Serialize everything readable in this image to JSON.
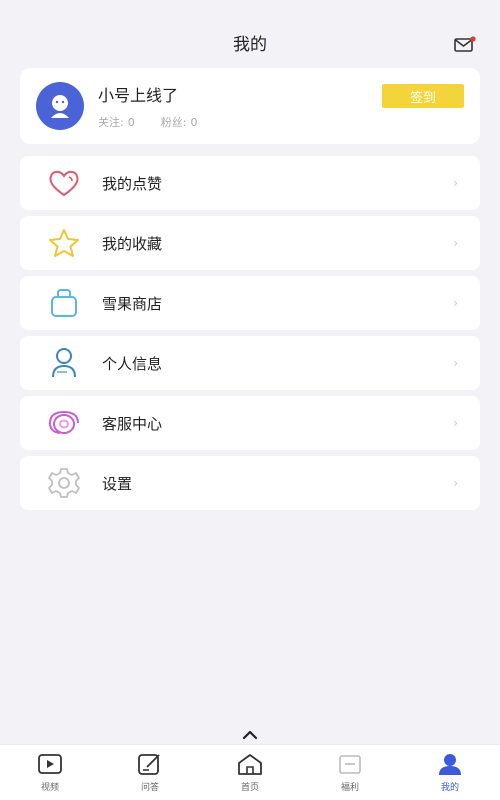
{
  "header": {
    "title": "我的",
    "mail_icon": "mail-icon"
  },
  "profile": {
    "nickname": "小号上线了",
    "follow_label": "关注:",
    "follow_count": "0",
    "fans_label": "粉丝:",
    "fans_count": "0",
    "signin_label": "签到",
    "avatar_icon": "avatar-icon"
  },
  "menu": [
    {
      "label": "我的点赞",
      "icon": "heart-icon",
      "color": "#e2576c"
    },
    {
      "label": "我的收藏",
      "icon": "star-icon",
      "color": "#f2c531"
    },
    {
      "label": "雪果商店",
      "icon": "shopping-bag-icon",
      "color": "#5fb4e6"
    },
    {
      "label": "个人信息",
      "icon": "user-icon",
      "color": "#3b82c4"
    },
    {
      "label": "客服中心",
      "icon": "customer-service-icon",
      "color": "#c85fd1"
    },
    {
      "label": "设置",
      "icon": "gear-icon",
      "color": "#bfbfbf"
    }
  ],
  "tabbar": [
    {
      "label": "视频",
      "icon": "video-icon"
    },
    {
      "label": "问答",
      "icon": "edit-icon"
    },
    {
      "label": "首页",
      "icon": "home-icon"
    },
    {
      "label": "福利",
      "icon": "gift-icon"
    },
    {
      "label": "我的",
      "icon": "profile-icon",
      "active": true
    }
  ],
  "colors": {
    "accent": "#3b5bdb",
    "signin": "#f3d43a",
    "avatar": "#4a63d6"
  }
}
